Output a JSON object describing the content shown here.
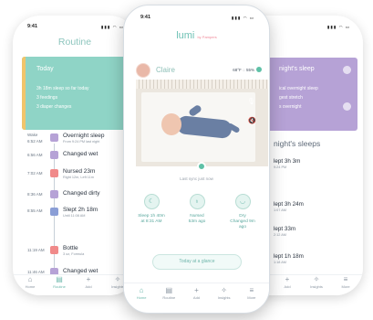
{
  "left_phone": {
    "status_time": "9:41",
    "title": "Routine",
    "today_card": {
      "title": "Today",
      "lines": [
        "3h 18m sleep so far today",
        "3 feedings",
        "3 diaper changes"
      ]
    },
    "timeline": [
      {
        "time": "Wake",
        "time2": "6:52 AM",
        "label": "Overnight sleep",
        "sub": "From 9:24 PM last night",
        "color": "#b6a2d6",
        "icon": "moon-icon"
      },
      {
        "time": "6:56 AM",
        "label": "Changed wet",
        "sub": "",
        "color": "#b6a2d6",
        "icon": "diaper-icon"
      },
      {
        "time": "7:02 AM",
        "label": "Nursed 23m",
        "sub": "Right 12m, Left 11m",
        "color": "#f08a8a",
        "icon": "bottle-icon"
      },
      {
        "time": "8:36 AM",
        "label": "Changed dirty",
        "sub": "",
        "color": "#b6a2d6",
        "icon": "diaper-icon"
      },
      {
        "time": "8:55 AM",
        "label": "Slept 2h 18m",
        "sub": "Until 11:08 AM",
        "color": "#8a9ed6",
        "icon": "moon-icon"
      },
      {
        "time": "11:19 AM",
        "label": "Bottle",
        "sub": "3 oz, Formula",
        "color": "#f08a8a",
        "icon": "bottle-icon"
      },
      {
        "time": "11:46 AM",
        "label": "Changed wet",
        "sub": "",
        "color": "#b6a2d6",
        "icon": "diaper-icon"
      }
    ],
    "tabs": [
      {
        "label": "Home",
        "icon": "home-icon",
        "glyph": "⌂",
        "active": false
      },
      {
        "label": "Routine",
        "icon": "routine-icon",
        "glyph": "▤",
        "active": true
      },
      {
        "label": "Add",
        "icon": "add-icon",
        "glyph": "+",
        "active": false
      },
      {
        "label": "Insights",
        "icon": "insights-icon",
        "glyph": "✧",
        "active": false
      }
    ]
  },
  "center_phone": {
    "status_time": "9:41",
    "logo": "lumi",
    "logo_sub": "by Pampers",
    "child_name": "Claire",
    "room_temp": "68°F",
    "room_humidity": "55%",
    "last_sync": "Last sync just now",
    "stats": [
      {
        "icon": "moon-icon",
        "glyph": "☾",
        "lines": [
          "Sleep 1h 40m",
          "at 8:31 AM"
        ]
      },
      {
        "icon": "bottle-icon",
        "glyph": "♁",
        "lines": [
          "Nursed",
          "53m ago"
        ]
      },
      {
        "icon": "diaper-icon",
        "glyph": "◡",
        "lines": [
          "Dry",
          "Changed 9m",
          "ago"
        ]
      }
    ],
    "glance_button": "Today at a glance",
    "tabs": [
      {
        "label": "Home",
        "icon": "home-icon",
        "glyph": "⌂",
        "active": true
      },
      {
        "label": "Routine",
        "icon": "routine-icon",
        "glyph": "▤",
        "active": false
      },
      {
        "label": "Add",
        "icon": "add-icon",
        "glyph": "+",
        "active": false
      },
      {
        "label": "Insights",
        "icon": "insights-icon",
        "glyph": "✧",
        "active": false
      },
      {
        "label": "More",
        "icon": "more-icon",
        "glyph": "≡",
        "active": false
      }
    ]
  },
  "right_phone": {
    "sleep_card": {
      "title": "night's sleep",
      "lines": [
        "ical overnight sleep",
        "gest stretch",
        "s overnight"
      ]
    },
    "section_title": "night's sleeps",
    "sleeps": [
      {
        "value": "lept 3h 3m",
        "sub": "9:24 PM"
      },
      {
        "value": "lept 3h 24m",
        "sub": "1:07 AM"
      },
      {
        "value": "lept 33m",
        "sub": "2:12 AM"
      },
      {
        "value": "lept 1h 18m",
        "sub": "1:18 AM"
      }
    ],
    "tabs": [
      {
        "label": "Add",
        "icon": "add-icon",
        "glyph": "+",
        "active": false
      },
      {
        "label": "Insights",
        "icon": "insights-icon",
        "glyph": "✧",
        "active": false
      },
      {
        "label": "More",
        "icon": "more-icon",
        "glyph": "≡",
        "active": false
      }
    ]
  }
}
